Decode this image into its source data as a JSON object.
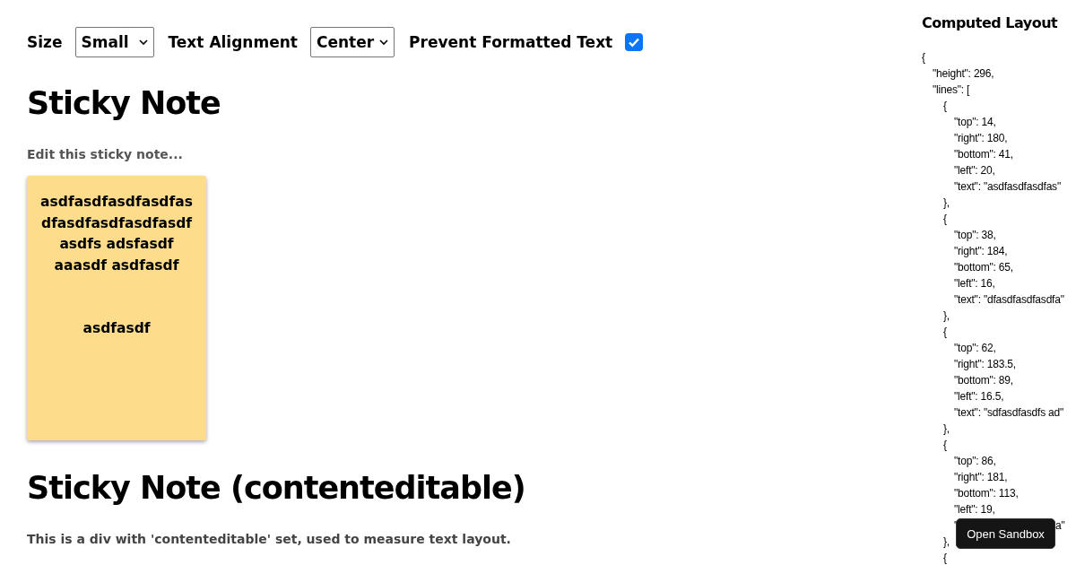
{
  "controls": {
    "size": {
      "label": "Size",
      "value": "Small"
    },
    "alignment": {
      "label": "Text Alignment",
      "value": "Center"
    },
    "prevent_formatted": {
      "label": "Prevent Formatted Text",
      "checked": true
    }
  },
  "sticky_note": {
    "heading": "Sticky Note",
    "hint": "Edit this sticky note...",
    "paragraphs": [
      {
        "lines": [
          "asdfasdfasdfasdfas",
          "dfasdfasdfasdfasdf",
          "asdfs adsfasdf",
          "aaasdf asdfasdf"
        ]
      },
      {
        "lines": [
          "asdfasdf"
        ]
      }
    ]
  },
  "contenteditable": {
    "heading": "Sticky Note (contenteditable)",
    "description": "This is a div with 'contenteditable' set, used to measure text layout."
  },
  "computed_layout": {
    "title": "Computed Layout",
    "code": [
      {
        "text": "{",
        "children": [
          {
            "text": "\"height\": 296,"
          },
          {
            "text": "\"lines\": [",
            "children": [
              {
                "text": "{",
                "children": [
                  {
                    "text": "\"top\": 14,"
                  },
                  {
                    "text": "\"right\": 180,"
                  },
                  {
                    "text": "\"bottom\": 41,"
                  },
                  {
                    "text": "\"left\": 20,"
                  },
                  {
                    "text": "\"text\": \"asdfasdfasdfas\""
                  }
                ]
              },
              {
                "text": "},"
              },
              {
                "text": "{",
                "children": [
                  {
                    "text": "\"top\": 38,"
                  },
                  {
                    "text": "\"right\": 184,"
                  },
                  {
                    "text": "\"bottom\": 65,"
                  },
                  {
                    "text": "\"left\": 16,"
                  },
                  {
                    "text": "\"text\": \"dfasdfasdfasdfa\""
                  }
                ]
              },
              {
                "text": "},"
              },
              {
                "text": "{",
                "children": [
                  {
                    "text": "\"top\": 62,"
                  },
                  {
                    "text": "\"right\": 183.5,"
                  },
                  {
                    "text": "\"bottom\": 89,"
                  },
                  {
                    "text": "\"left\": 16.5,"
                  },
                  {
                    "text": "\"text\": \"sdfasdfasdfs ad\""
                  }
                ]
              },
              {
                "text": "},"
              },
              {
                "text": "{",
                "children": [
                  {
                    "text": "\"top\": 86,"
                  },
                  {
                    "text": "\"right\": 181,"
                  },
                  {
                    "text": "\"bottom\": 113,"
                  },
                  {
                    "text": "\"left\": 19,"
                  },
                  {
                    "kind": "covered",
                    "start": "\"",
                    "end": "a\""
                  }
                ]
              },
              {
                "text": "},"
              },
              {
                "text": "{"
              }
            ]
          }
        ]
      }
    ]
  },
  "sandbox_button": {
    "label": "Open Sandbox"
  }
}
